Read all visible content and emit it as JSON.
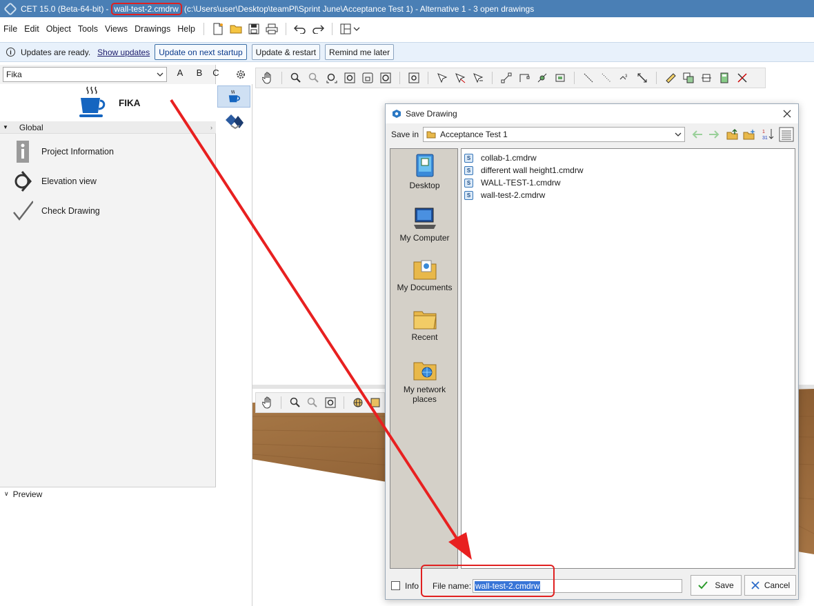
{
  "titlebar": {
    "app": "CET 15.0 (Beta-64-bit)",
    "separator": "-",
    "filename": "wall-test-2.cmdrw",
    "rest": "(c:\\Users\\user\\Desktop\\teamPl\\Sprint June\\Acceptance Test 1) - Alternative 1 - 3  open drawings"
  },
  "menubar": {
    "items": [
      "File",
      "Edit",
      "Object",
      "Tools",
      "Views",
      "Drawings",
      "Help"
    ]
  },
  "updatebar": {
    "message": "Updates are ready.",
    "show_updates": "Show updates",
    "update_next_startup": "Update on next startup",
    "update_restart": "Update & restart",
    "remind_later": "Remind me later"
  },
  "leftpanel": {
    "library": "Fika",
    "abc": [
      "A",
      "B",
      "C"
    ],
    "header_title": "FIKA",
    "group": "Global",
    "items": [
      "Project Information",
      "Elevation view",
      "Check Drawing"
    ],
    "preview": "Preview"
  },
  "dialog": {
    "title": "Save Drawing",
    "save_in_label": "Save in",
    "save_in_value": "Acceptance Test 1",
    "places": [
      "Desktop",
      "My Computer",
      "My Documents",
      "Recent",
      "My network places"
    ],
    "files": [
      "collab-1.cmdrw",
      "different wall height1.cmdrw",
      "WALL-TEST-1.cmdrw",
      "wall-test-2.cmdrw"
    ],
    "info_label": "Info",
    "file_name_label": "File name:",
    "file_name_value": "wall-test-2.cmdrw",
    "save_button": "Save",
    "cancel_button": "Cancel"
  },
  "colors": {
    "titlebar": "#4a7fb5",
    "annotation": "#e02020",
    "selection": "#3875d7",
    "wood": "#9a6b3c"
  }
}
